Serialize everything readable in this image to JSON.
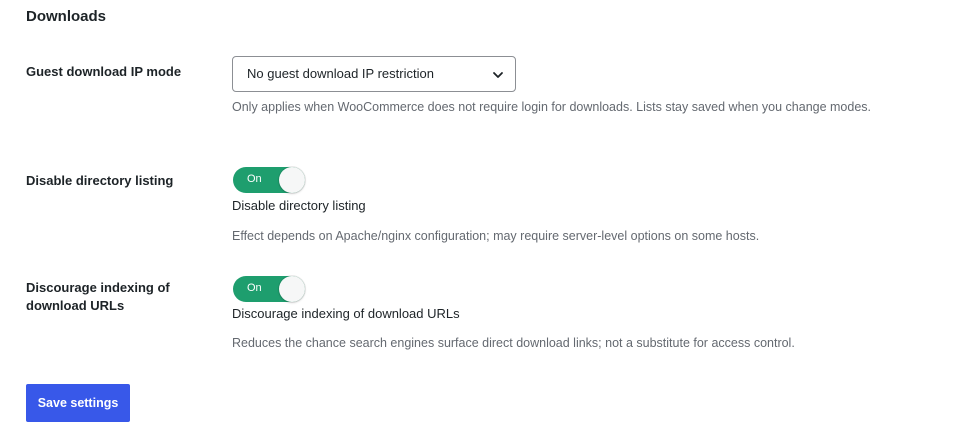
{
  "section": {
    "title": "Downloads"
  },
  "guest_ip_mode": {
    "label": "Guest download IP mode",
    "selected": "No guest download IP restriction",
    "description": "Only applies when WooCommerce does not require login for downloads. Lists stay saved when you change modes."
  },
  "disable_listing": {
    "label": "Disable directory listing",
    "state": "On",
    "caption": "Disable directory listing",
    "description": "Effect depends on Apache/nginx configuration; may require server-level options on some hosts."
  },
  "discourage_indexing": {
    "label": "Discourage indexing of download URLs",
    "state": "On",
    "caption": "Discourage indexing of download URLs",
    "description": "Reduces the chance search engines surface direct download links; not a substitute for access control."
  },
  "actions": {
    "save_label": "Save settings"
  },
  "colors": {
    "toggle_on": "#1e9e6e",
    "primary_button": "#3858e9"
  },
  "icons": {
    "select_chevron": "chevron-down-icon"
  }
}
